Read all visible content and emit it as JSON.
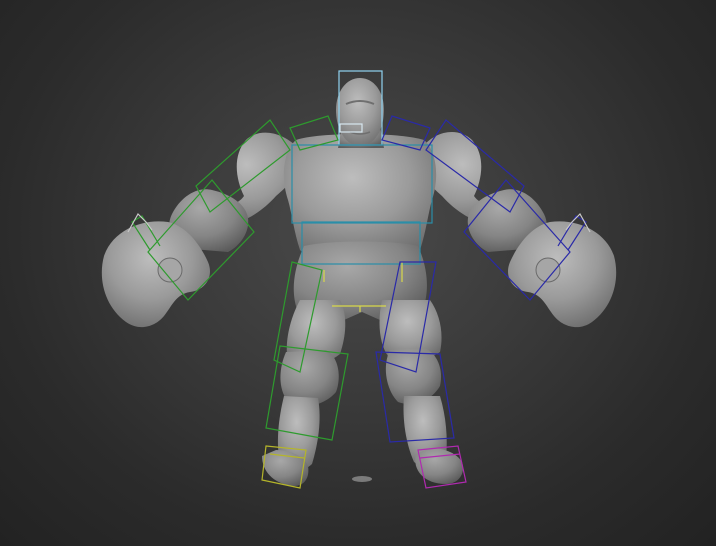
{
  "viewport": {
    "background_color": "#3a3a3a",
    "model_color": "#9a9a9a",
    "rig_colors": {
      "head": "#8fd3f0",
      "spine": "#2a8ea8",
      "left_side": "#2e9b2e",
      "right_side": "#2a2aa8",
      "left_foot": "#b5b52a",
      "right_foot": "#b02ab0",
      "pelvis_axis": "#d8d84a"
    }
  }
}
